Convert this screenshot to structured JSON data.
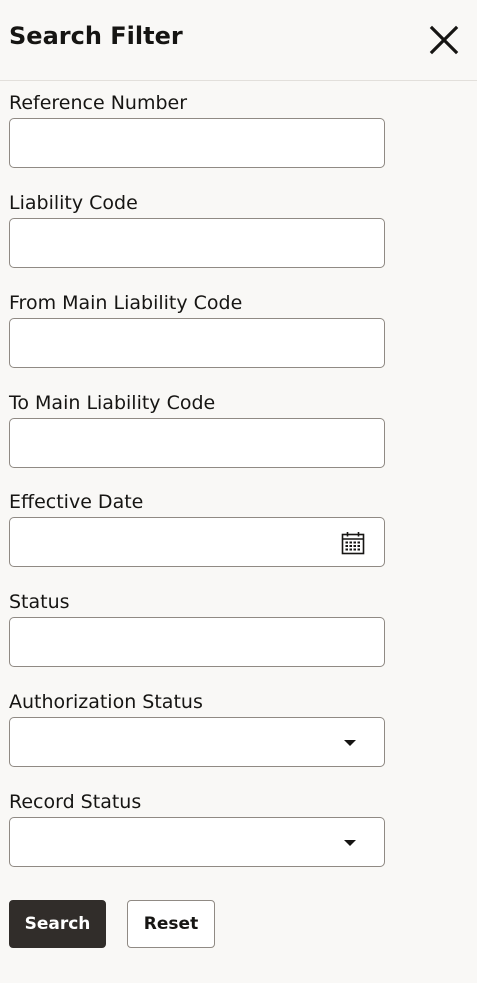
{
  "header": {
    "title": "Search Filter",
    "close_icon": "close-icon"
  },
  "fields": [
    {
      "label": "Reference Number",
      "value": "",
      "type": "text"
    },
    {
      "label": "Liability Code",
      "value": "",
      "type": "text"
    },
    {
      "label": "From Main Liability Code",
      "value": "",
      "type": "text"
    },
    {
      "label": "To Main Liability Code",
      "value": "",
      "type": "text"
    },
    {
      "label": "Effective Date",
      "value": "",
      "type": "date",
      "icon": "calendar-icon"
    },
    {
      "label": "Status",
      "value": "",
      "type": "text"
    },
    {
      "label": "Authorization Status",
      "value": "",
      "type": "select",
      "icon": "chevron-down-icon"
    },
    {
      "label": "Record Status",
      "value": "",
      "type": "select",
      "icon": "chevron-down-icon"
    }
  ],
  "buttons": {
    "search_label": "Search",
    "reset_label": "Reset"
  },
  "colors": {
    "background": "#f9f8f6",
    "primary_button": "#312d2a",
    "border": "#908a84"
  }
}
